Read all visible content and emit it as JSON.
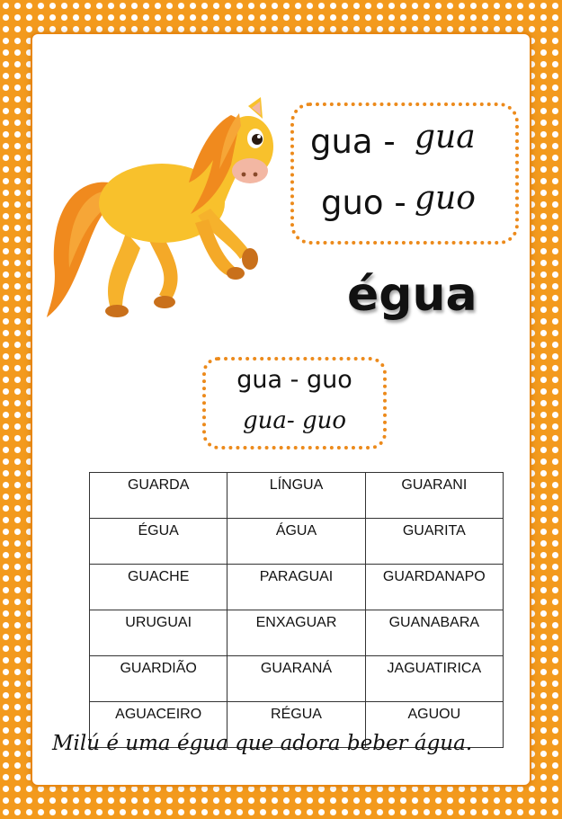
{
  "top_box": {
    "line1_print": "gua -",
    "line1_cursive": "gua",
    "line2_print": "guo -",
    "line2_cursive": "guo"
  },
  "title_word": "égua",
  "mid_box": {
    "print": "gua - guo",
    "cursive": "gua- guo"
  },
  "word_table": [
    [
      "GUARDA",
      "LÍNGUA",
      "GUARANI"
    ],
    [
      "ÉGUA",
      "ÁGUA",
      "GUARITA"
    ],
    [
      "GUACHE",
      "PARAGUAI",
      "GUARDANAPO"
    ],
    [
      "URUGUAI",
      "ENXAGUAR",
      "GUANABARA"
    ],
    [
      "GUARDIÃO",
      "GUARANÁ",
      "JAGUATIRICA"
    ],
    [
      "AGUACEIRO",
      "RÉGUA",
      "AGUOU"
    ]
  ],
  "sentence": "Milú é uma égua que adora beber água.",
  "colors": {
    "frame_orange": "#f39a1d",
    "dot_border": "#ec8a1b",
    "horse_body": "#f8c12c"
  },
  "icons": [
    "horse-illustration"
  ]
}
